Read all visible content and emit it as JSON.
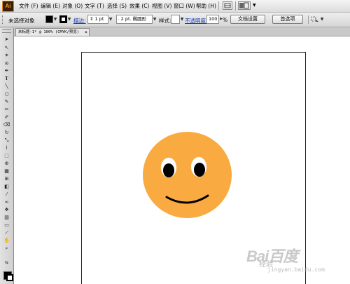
{
  "app": {
    "logo_text": "Ai"
  },
  "menubar": {
    "items": [
      "文件 (F)",
      "编辑 (E)",
      "对象 (O)",
      "文字 (T)",
      "选择 (S)",
      "效果 (C)",
      "视图 (V)",
      "窗口 (W)",
      "帮助 (H)"
    ]
  },
  "controlbar": {
    "selection_label": "未选择对象",
    "fill_color": "#000000",
    "stroke_label": "描边:",
    "stroke_weight": "1 pt",
    "brush_value": "2 pt. 椭圆形",
    "style_label": "样式:",
    "opacity_label": "不透明度:",
    "opacity_value": "100",
    "opacity_unit": "%",
    "doc_setup_button": "文档设置",
    "preferences_button": "首选项"
  },
  "document_tab": {
    "title": "未标题-1* @ 100% (CMYK/预览)",
    "close_label": "×"
  },
  "canvas": {
    "background": "#ffffff",
    "artwork": {
      "face_color": "#f9ab42",
      "eye_white": "#ffffff",
      "pupil_color": "#000000",
      "mouth_color": "#000000"
    }
  },
  "watermark": {
    "logo": "Bai百度",
    "sub": "经验",
    "url": "jingyan.baidu.com"
  }
}
